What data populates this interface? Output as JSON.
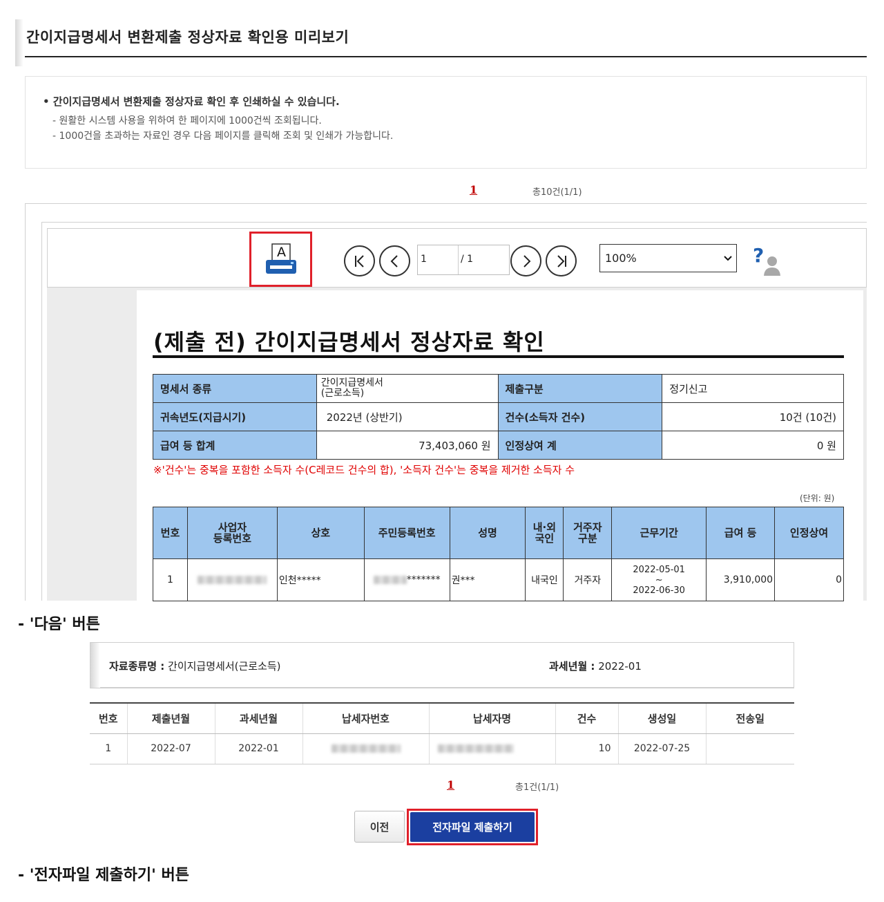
{
  "header": {
    "title": "간이지급명세서 변환제출 정상자료 확인용 미리보기"
  },
  "notice": {
    "headline": "• 간이지급명세서 변환제출 정상자료 확인 후 인쇄하실 수 있습니다.",
    "lines": [
      "- 원활한 시스템 사용을 위하여 한 페이지에 1000건씩 조회됩니다.",
      "- 1000건을 초과하는 자료인 경우 다음 페이지를 클릭해 조회 및 인쇄가 가능합니다."
    ]
  },
  "pager_top": {
    "page": "1",
    "total": "총10건(1/1)"
  },
  "viewer": {
    "page_current": "1",
    "page_total": "/ 1",
    "zoom": "100%",
    "print_icon_letter": "A",
    "icons": [
      "printer-icon",
      "first-page-icon",
      "prev-page-icon",
      "next-page-icon",
      "last-page-icon",
      "help-icon"
    ]
  },
  "report": {
    "title": "(제출 전) 간이지급명세서 정상자료 확인",
    "info": {
      "kind_label": "명세서 종류",
      "kind_value_1": "간이지급명세서",
      "kind_value_2": "(근로소득)",
      "submit_type_label": "제출구분",
      "submit_type_value": "정기신고",
      "year_label": "귀속년도(지급시기)",
      "year_value": "2022년 (상반기)",
      "count_label": "건수(소득자 건수)",
      "count_value": "10건 (10건)",
      "pay_label": "급여 등 합계",
      "pay_value": "73,403,060 원",
      "bonus_label": "인정상여 계",
      "bonus_value": "0 원"
    },
    "note": "※'건수'는 중복을 포함한 소득자 수(C레코드 건수의 합), '소득자 건수'는 중복을 제거한 소득자 수",
    "unit": "(단위: 원)",
    "columns": [
      "번호",
      "사업자\n등록번호",
      "상호",
      "주민등록번호",
      "성명",
      "내·외\n국인",
      "거주자\n구분",
      "근무기간",
      "급여 등",
      "인정상여"
    ],
    "rows": [
      {
        "no": "1",
        "biz_no": "",
        "company": "인천*****",
        "resident_no_suffix": "*******",
        "name": "권***",
        "nationality": "내국인",
        "residency": "거주자",
        "period_from": "2022-05-01",
        "period_sep": "~",
        "period_to": "2022-06-30",
        "pay": "3,910,000",
        "bonus": "0"
      }
    ]
  },
  "labels": {
    "next_button_caption": "- '다음' 버튼",
    "submit_button_caption": "- '전자파일 제출하기' 버튼"
  },
  "panel2": {
    "type_label": "자료종류명 :",
    "type_value": "간이지급명세서(근로소득)",
    "tax_month_label": "과세년월 :",
    "tax_month_value": "2022-01",
    "columns": [
      "번호",
      "제출년월",
      "과세년월",
      "납세자번호",
      "납세자명",
      "건수",
      "생성일",
      "전송일"
    ],
    "rows": [
      {
        "no": "1",
        "submit_month": "2022-07",
        "tax_month": "2022-01",
        "taxpayer_no": "",
        "taxpayer_name": "",
        "count": "10",
        "created": "2022-07-25",
        "sent": ""
      }
    ],
    "pager": {
      "page": "1",
      "total": "총1건(1/1)"
    },
    "buttons": {
      "prev": "이전",
      "submit": "전자파일 제출하기"
    }
  }
}
